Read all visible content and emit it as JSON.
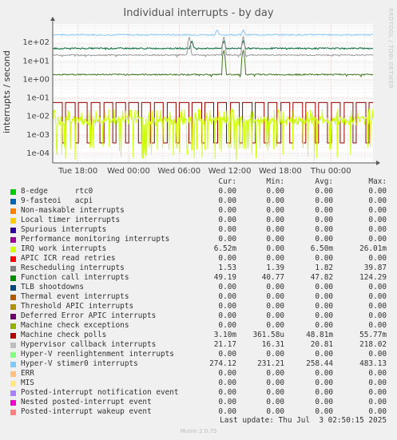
{
  "chart_data": {
    "type": "line",
    "title": "Individual interrupts - by day",
    "ylabel": "interrupts / second",
    "xlabel": "",
    "yscale": "log",
    "ylim": [
      3e-05,
      1000
    ],
    "xlim": [
      -3,
      35
    ],
    "x_unit": "hours since Tue 18:00",
    "x_ticks": [
      {
        "pos": 0,
        "label": "Tue 18:00"
      },
      {
        "pos": 6,
        "label": "Wed 00:00"
      },
      {
        "pos": 12,
        "label": "Wed 06:00"
      },
      {
        "pos": 18,
        "label": "Wed 12:00"
      },
      {
        "pos": 24,
        "label": "Wed 18:00"
      },
      {
        "pos": 30,
        "label": "Thu 00:00"
      }
    ],
    "y_ticks": [
      {
        "value": 0.0001,
        "label": "1e-04"
      },
      {
        "value": 0.001,
        "label": "1e-03"
      },
      {
        "value": 0.01,
        "label": "1e-02"
      },
      {
        "value": 0.1,
        "label": "1e-01"
      },
      {
        "value": 1,
        "label": "1e+00"
      },
      {
        "value": 10,
        "label": "1e+01"
      },
      {
        "value": 100,
        "label": "1e+02"
      }
    ],
    "grid": true,
    "series": [
      {
        "name": "Hyper-V stimer0 interrupts",
        "color": "#88c7f7",
        "base": 258.44,
        "min": 231.21,
        "max": 483.13,
        "peaks": [
          16.5,
          19.6
        ]
      },
      {
        "name": "Function call interrupts",
        "color": "#006633",
        "base": 47.82,
        "min": 40.77,
        "max": 124.29,
        "peaks": [
          13.5,
          17.3,
          19.6
        ]
      },
      {
        "name": "Hypervisor callback interrupts",
        "color": "#999999",
        "base": 20.81,
        "min": 16.31,
        "max": 218.02,
        "peaks": [
          13.2,
          17.3,
          19.6
        ]
      },
      {
        "name": "Rescheduling interrupts",
        "color": "#447722",
        "base": 1.82,
        "min": 1.39,
        "max": 39.87,
        "peaks": [
          17.3,
          19.6
        ]
      },
      {
        "name": "Machine check polls",
        "color": "#990000",
        "pattern": "square",
        "high": 0.05577,
        "low": 0.000361,
        "period": 1.5
      },
      {
        "name": "IRQ work interrupts",
        "color": "#ccff00",
        "pattern": "noise",
        "base": 0.0065,
        "min": 4e-05,
        "max": 0.02601
      }
    ]
  },
  "legend": {
    "headers": [
      "Cur:",
      "Min:",
      "Avg:",
      "Max:"
    ],
    "rows": [
      {
        "name": "8-edge      rtc0",
        "color": "#00cc00",
        "cur": "0.00",
        "min": "0.00",
        "avg": "0.00",
        "max": "0.00"
      },
      {
        "name": "9-fasteoi   acpi",
        "color": "#0066b3",
        "cur": "0.00",
        "min": "0.00",
        "avg": "0.00",
        "max": "0.00"
      },
      {
        "name": "Non-maskable interrupts",
        "color": "#ff8000",
        "cur": "0.00",
        "min": "0.00",
        "avg": "0.00",
        "max": "0.00"
      },
      {
        "name": "Local timer interrupts",
        "color": "#ffcc00",
        "cur": "0.00",
        "min": "0.00",
        "avg": "0.00",
        "max": "0.00"
      },
      {
        "name": "Spurious interrupts",
        "color": "#330099",
        "cur": "0.00",
        "min": "0.00",
        "avg": "0.00",
        "max": "0.00"
      },
      {
        "name": "Performance monitoring interrupts",
        "color": "#990099",
        "cur": "0.00",
        "min": "0.00",
        "avg": "0.00",
        "max": "0.00"
      },
      {
        "name": "IRQ work interrupts",
        "color": "#ccff00",
        "cur": "6.52m",
        "min": "0.00",
        "avg": "6.50m",
        "max": "26.01m"
      },
      {
        "name": "APIC ICR read retries",
        "color": "#ff0000",
        "cur": "0.00",
        "min": "0.00",
        "avg": "0.00",
        "max": "0.00"
      },
      {
        "name": "Rescheduling interrupts",
        "color": "#808080",
        "cur": "1.53",
        "min": "1.39",
        "avg": "1.82",
        "max": "39.87"
      },
      {
        "name": "Function call interrupts",
        "color": "#008f00",
        "cur": "49.19",
        "min": "40.77",
        "avg": "47.82",
        "max": "124.29"
      },
      {
        "name": "TLB shootdowns",
        "color": "#00487d",
        "cur": "0.00",
        "min": "0.00",
        "avg": "0.00",
        "max": "0.00"
      },
      {
        "name": "Thermal event interrupts",
        "color": "#b35a00",
        "cur": "0.00",
        "min": "0.00",
        "avg": "0.00",
        "max": "0.00"
      },
      {
        "name": "Threshold APIC interrupts",
        "color": "#b38f00",
        "cur": "0.00",
        "min": "0.00",
        "avg": "0.00",
        "max": "0.00"
      },
      {
        "name": "Deferred Error APIC interrupts",
        "color": "#6b006b",
        "cur": "0.00",
        "min": "0.00",
        "avg": "0.00",
        "max": "0.00"
      },
      {
        "name": "Machine check exceptions",
        "color": "#8fb300",
        "cur": "0.00",
        "min": "0.00",
        "avg": "0.00",
        "max": "0.00"
      },
      {
        "name": "Machine check polls",
        "color": "#b30000",
        "cur": "3.10m",
        "min": "361.58u",
        "avg": "48.81m",
        "max": "55.77m"
      },
      {
        "name": "Hypervisor callback interrupts",
        "color": "#bebebe",
        "cur": "21.17",
        "min": "16.31",
        "avg": "20.81",
        "max": "218.02"
      },
      {
        "name": "Hyper-V reenlightenment interrupts",
        "color": "#80ff80",
        "cur": "0.00",
        "min": "0.00",
        "avg": "0.00",
        "max": "0.00"
      },
      {
        "name": "Hyper-V stimer0 interrupts",
        "color": "#80c9ff",
        "cur": "274.12",
        "min": "231.21",
        "avg": "258.44",
        "max": "483.13"
      },
      {
        "name": "ERR",
        "color": "#ffc080",
        "cur": "0.00",
        "min": "0.00",
        "avg": "0.00",
        "max": "0.00"
      },
      {
        "name": "MIS",
        "color": "#ffe680",
        "cur": "0.00",
        "min": "0.00",
        "avg": "0.00",
        "max": "0.00"
      },
      {
        "name": "Posted-interrupt notification event",
        "color": "#aa80ff",
        "cur": "0.00",
        "min": "0.00",
        "avg": "0.00",
        "max": "0.00"
      },
      {
        "name": "Nested posted-interrupt event",
        "color": "#ee00cc",
        "cur": "0.00",
        "min": "0.00",
        "avg": "0.00",
        "max": "0.00"
      },
      {
        "name": "Posted-interrupt wakeup event",
        "color": "#ff8080",
        "cur": "0.00",
        "min": "0.00",
        "avg": "0.00",
        "max": "0.00"
      }
    ]
  },
  "last_update": "Last update: Thu Jul  3 02:50:15 2025",
  "side_credit": "RRDTOOL / TOBI OETIKER",
  "footer": "Munin 2.0.75"
}
